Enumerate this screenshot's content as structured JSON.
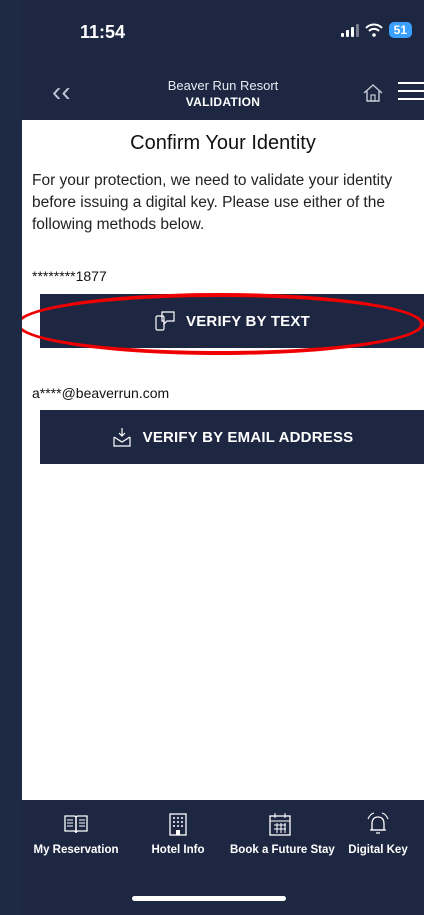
{
  "status_bar": {
    "time": "11:54",
    "battery": "51"
  },
  "header": {
    "resort_name": "Beaver Run Resort",
    "subtitle": "VALIDATION"
  },
  "main": {
    "title": "Confirm Your Identity",
    "description": "For your protection, we need to validate your identity before issuing a digital key. Please use either of the following methods below.",
    "phone_masked": "********1877",
    "verify_text_label": "VERIFY BY TEXT",
    "email_masked": "a****@beaverrun.com",
    "verify_email_label": "VERIFY BY EMAIL ADDRESS"
  },
  "tabs": [
    {
      "label": "My Reservation",
      "icon": "book-icon"
    },
    {
      "label": "Hotel Info",
      "icon": "building-icon"
    },
    {
      "label": "Book a Future Stay",
      "icon": "calendar-icon"
    },
    {
      "label": "Digital Key",
      "icon": "bell-icon"
    }
  ],
  "colors": {
    "navy": "#1d2742",
    "highlight": "#e00000",
    "battery": "#3aa0ff"
  }
}
